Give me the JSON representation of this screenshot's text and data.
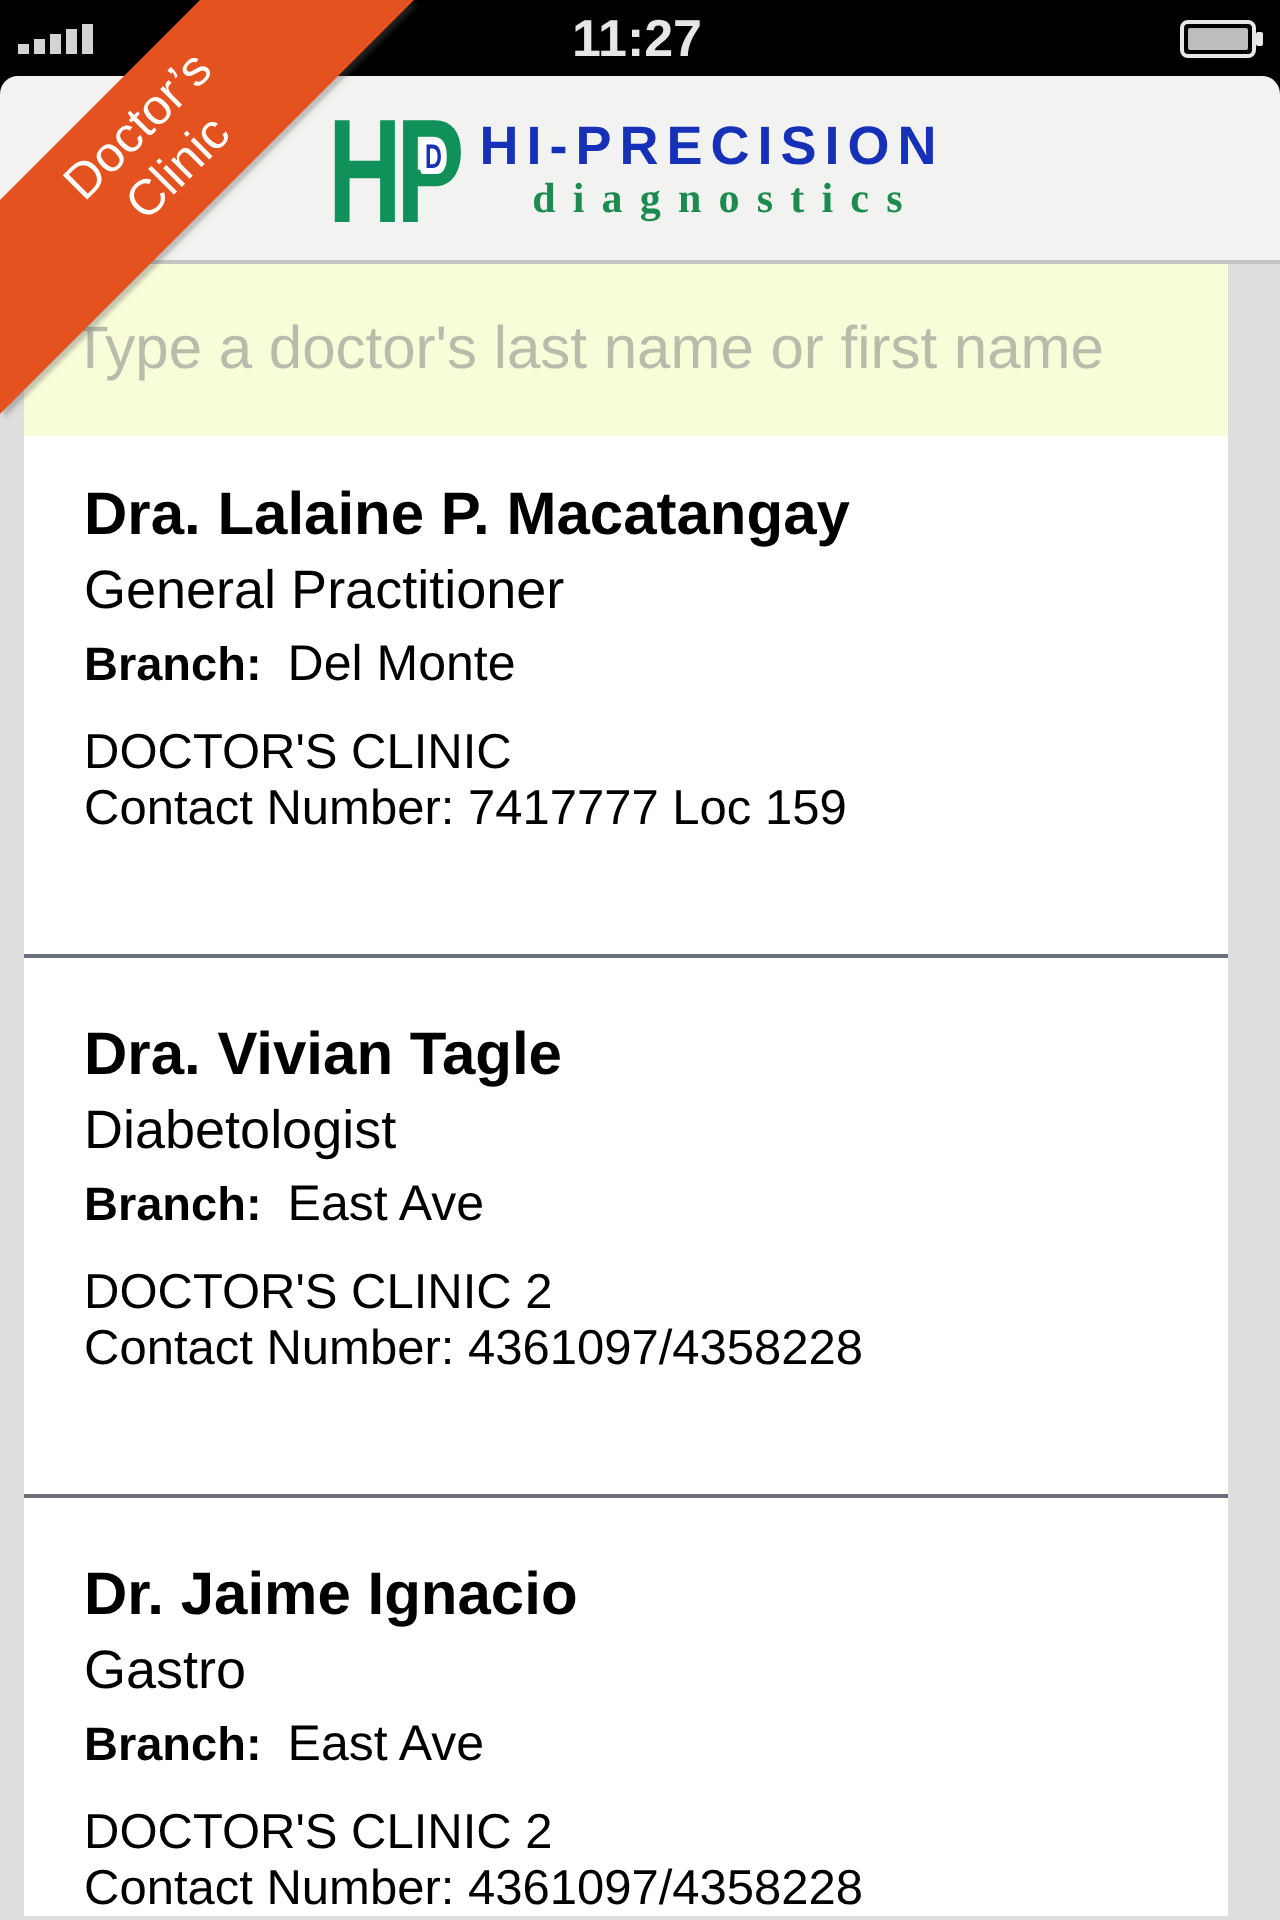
{
  "status_bar": {
    "time": "11:27"
  },
  "ribbon": {
    "lines": [
      "Doctor’s",
      "Clinic"
    ]
  },
  "header": {
    "logo": {
      "mark": "HP",
      "mark_inner": "D",
      "name": "HI-PRECISION",
      "tagline": "diagnostics"
    }
  },
  "search": {
    "placeholder": "Type a doctor's last name or first name"
  },
  "doctors": [
    {
      "name": "Dra. Lalaine P. Macatangay",
      "specialty": "General Practitioner",
      "branch_label": "Branch:",
      "branch": "Del Monte",
      "clinic": "DOCTOR'S CLINIC",
      "contact": "Contact Number: 7417777 Loc 159"
    },
    {
      "name": "Dra. Vivian Tagle",
      "specialty": "Diabetologist",
      "branch_label": "Branch:",
      "branch": "East Ave",
      "clinic": "DOCTOR'S CLINIC 2",
      "contact": "Contact Number: 4361097/4358228"
    },
    {
      "name": "Dr. Jaime Ignacio",
      "specialty": "Gastro",
      "branch_label": "Branch:",
      "branch": "East Ave",
      "clinic": "DOCTOR'S CLINIC 2",
      "contact": "Contact Number: 4361097/4358228"
    }
  ]
}
